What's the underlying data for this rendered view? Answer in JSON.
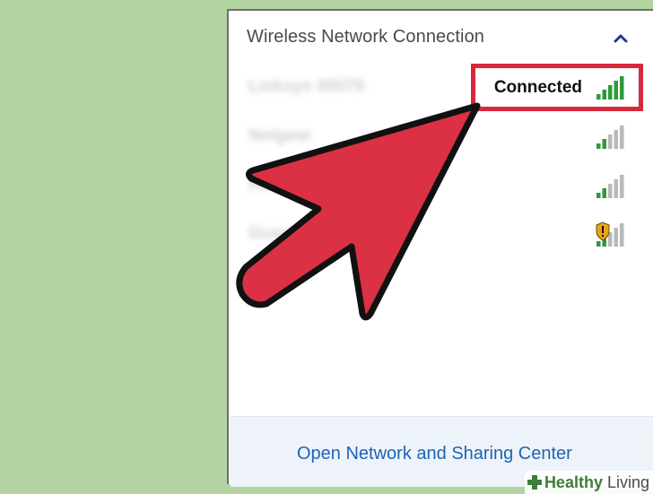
{
  "panel": {
    "title": "Wireless Network Connection",
    "collapse_icon": "chevron-up-icon"
  },
  "networks": [
    {
      "name": "Linksys 00078",
      "status": "Connected",
      "signal_bars": 5,
      "secured": true,
      "warning": false
    },
    {
      "name": "Netgear",
      "status": "",
      "signal_bars": 2,
      "secured": true,
      "warning": false
    },
    {
      "name": "HomeNet",
      "status": "",
      "signal_bars": 2,
      "secured": true,
      "warning": false
    },
    {
      "name": "Guest Network",
      "status": "",
      "signal_bars": 2,
      "secured": false,
      "warning": true
    }
  ],
  "footer": {
    "link_label": "Open Network and Sharing Center"
  },
  "annotations": {
    "highlight_color": "#d9283d",
    "arrow_color": "#dc3044"
  },
  "watermark": {
    "brand_bold": "Healthy",
    "brand_thin": " Living"
  },
  "colors": {
    "background": "#b3d3a1",
    "signal_active": "#2e9a3b",
    "signal_inactive": "#b9b9b9",
    "link": "#1c64b7"
  }
}
